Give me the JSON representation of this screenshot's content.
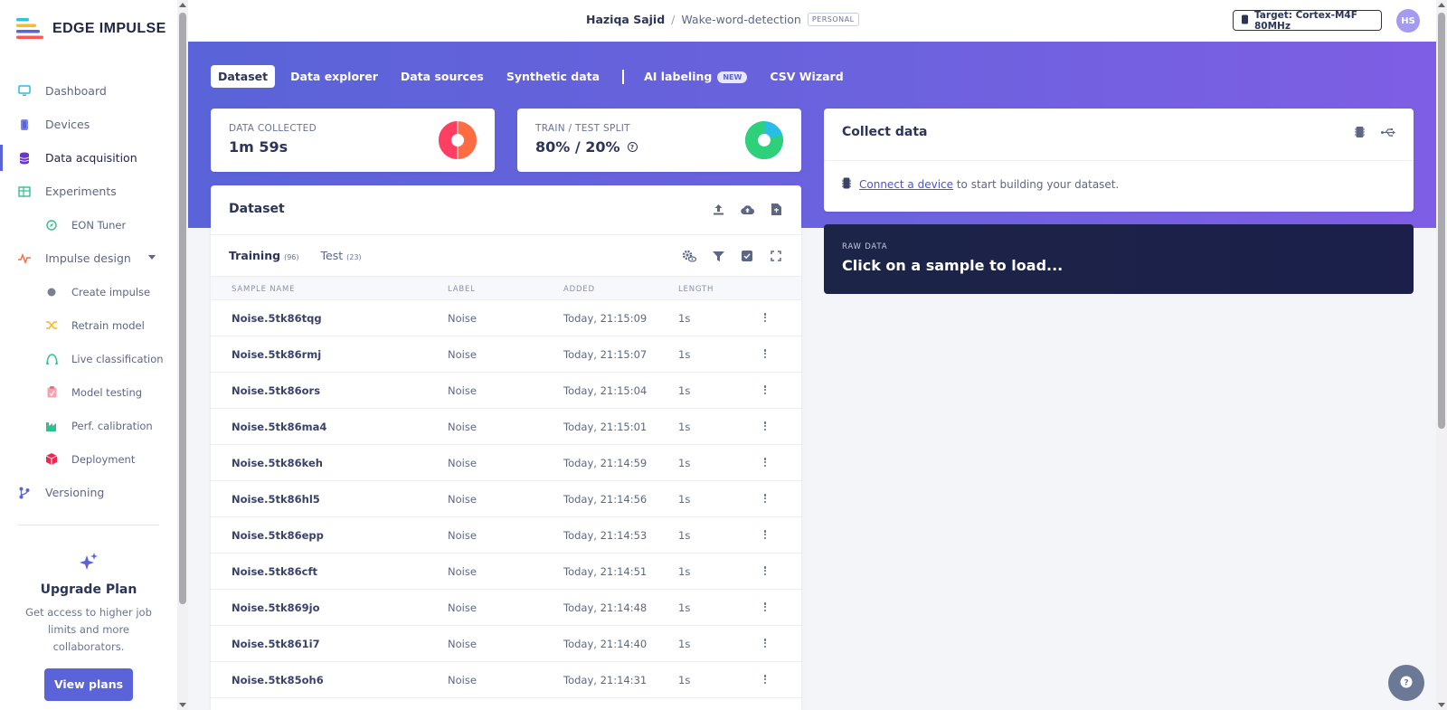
{
  "brand": {
    "name": "EDGE IMPULSE"
  },
  "sidebar": {
    "items": [
      {
        "label": "Dashboard",
        "icon": "monitor-icon"
      },
      {
        "label": "Devices",
        "icon": "chip-icon"
      },
      {
        "label": "Data acquisition",
        "icon": "database-icon",
        "active": true
      },
      {
        "label": "Experiments",
        "icon": "table-icon"
      },
      {
        "label": "EON Tuner",
        "icon": "compass-icon",
        "sub": true
      },
      {
        "label": "Impulse design",
        "icon": "pulse-icon",
        "expandable": true
      },
      {
        "label": "Create impulse",
        "icon": "dot-icon",
        "sub": true
      },
      {
        "label": "Retrain model",
        "icon": "shuffle-icon",
        "sub": true
      },
      {
        "label": "Live classification",
        "icon": "live-icon",
        "sub": true
      },
      {
        "label": "Model testing",
        "icon": "clipboard-icon",
        "sub": true
      },
      {
        "label": "Perf. calibration",
        "icon": "factory-icon",
        "sub": true
      },
      {
        "label": "Deployment",
        "icon": "box-icon",
        "sub": true
      },
      {
        "label": "Versioning",
        "icon": "branch-icon"
      }
    ],
    "upgrade": {
      "title": "Upgrade Plan",
      "description": "Get access to higher job limits and more collaborators.",
      "button": "View plans"
    }
  },
  "topbar": {
    "user": "Haziqa Sajid",
    "separator": "/",
    "project": "Wake-word-detection",
    "badge": "PERSONAL",
    "target": "Target: Cortex-M4F 80MHz",
    "avatar": "HS"
  },
  "tabs": {
    "dataset": "Dataset",
    "explorer": "Data explorer",
    "sources": "Data sources",
    "synthetic": "Synthetic data",
    "ai_labeling": "AI labeling",
    "new_badge": "NEW",
    "csv": "CSV Wizard"
  },
  "stats": {
    "collected_label": "DATA COLLECTED",
    "collected_value": "1m 59s",
    "split_label": "TRAIN / TEST SPLIT",
    "split_value": "80% / 20%",
    "split_train_fraction": 0.8,
    "colors": {
      "collected_a": "#fe3e62",
      "collected_b": "#ff6c42",
      "train": "#2fd07a",
      "test": "#27bfe8"
    }
  },
  "dataset": {
    "title": "Dataset",
    "training_tab": "Training",
    "training_count": "(96)",
    "test_tab": "Test",
    "test_count": "(23)",
    "columns": {
      "name": "SAMPLE NAME",
      "label": "LABEL",
      "added": "ADDED",
      "length": "LENGTH"
    },
    "rows": [
      {
        "name": "Noise.5tk86tqg",
        "label": "Noise",
        "added": "Today, 21:15:09",
        "length": "1s"
      },
      {
        "name": "Noise.5tk86rmj",
        "label": "Noise",
        "added": "Today, 21:15:07",
        "length": "1s"
      },
      {
        "name": "Noise.5tk86ors",
        "label": "Noise",
        "added": "Today, 21:15:04",
        "length": "1s"
      },
      {
        "name": "Noise.5tk86ma4",
        "label": "Noise",
        "added": "Today, 21:15:01",
        "length": "1s"
      },
      {
        "name": "Noise.5tk86keh",
        "label": "Noise",
        "added": "Today, 21:14:59",
        "length": "1s"
      },
      {
        "name": "Noise.5tk86hl5",
        "label": "Noise",
        "added": "Today, 21:14:56",
        "length": "1s"
      },
      {
        "name": "Noise.5tk86epp",
        "label": "Noise",
        "added": "Today, 21:14:53",
        "length": "1s"
      },
      {
        "name": "Noise.5tk86cft",
        "label": "Noise",
        "added": "Today, 21:14:51",
        "length": "1s"
      },
      {
        "name": "Noise.5tk869jo",
        "label": "Noise",
        "added": "Today, 21:14:48",
        "length": "1s"
      },
      {
        "name": "Noise.5tk861i7",
        "label": "Noise",
        "added": "Today, 21:14:40",
        "length": "1s"
      },
      {
        "name": "Noise.5tk85oh6",
        "label": "Noise",
        "added": "Today, 21:14:31",
        "length": "1s"
      }
    ]
  },
  "collect": {
    "title": "Collect data",
    "link": "Connect a device",
    "text": "to start building your dataset."
  },
  "raw": {
    "label": "RAW DATA",
    "title": "Click on a sample to load..."
  },
  "accent": "#5a63d8"
}
